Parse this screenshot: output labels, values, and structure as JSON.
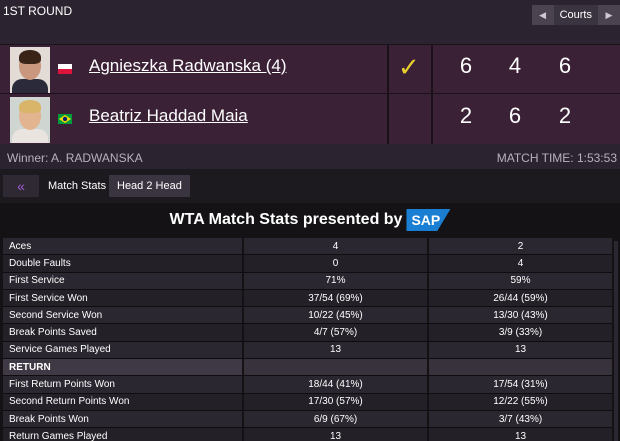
{
  "header": {
    "round": "1ST ROUND",
    "courts_label": "Courts",
    "prev_icon": "◀",
    "next_icon": "▶"
  },
  "players": [
    {
      "name": "Agnieszka Radwanska (4)",
      "flag": "poland",
      "winner_mark": "✓",
      "sets": [
        "6",
        "4",
        "6"
      ]
    },
    {
      "name": "Beatriz Haddad Maia",
      "flag": "brazil",
      "winner_mark": "",
      "sets": [
        "2",
        "6",
        "2"
      ]
    }
  ],
  "match": {
    "winner": "Winner: A. RADWANSKA",
    "time": "MATCH TIME: 1:53:53"
  },
  "tabs": {
    "back_icon": "«",
    "match_stats": "Match Stats",
    "head2head": "Head 2 Head"
  },
  "stats": {
    "sponsor_text": "WTA Match Stats presented by",
    "sponsor_logo": "SAP",
    "rows": [
      {
        "label": "Aces",
        "p1": "4",
        "p2": "2",
        "section": false
      },
      {
        "label": "Double Faults",
        "p1": "0",
        "p2": "4",
        "section": false
      },
      {
        "label": "First Service",
        "p1": "71%",
        "p2": "59%",
        "section": false
      },
      {
        "label": "First Service Won",
        "p1": "37/54 (69%)",
        "p2": "26/44 (59%)",
        "section": false
      },
      {
        "label": "Second Service Won",
        "p1": "10/22 (45%)",
        "p2": "13/30 (43%)",
        "section": false
      },
      {
        "label": "Break Points Saved",
        "p1": "4/7 (57%)",
        "p2": "3/9 (33%)",
        "section": false
      },
      {
        "label": "Service Games Played",
        "p1": "13",
        "p2": "13",
        "section": false
      },
      {
        "label": "RETURN",
        "p1": "",
        "p2": "",
        "section": true
      },
      {
        "label": "First Return Points Won",
        "p1": "18/44 (41%)",
        "p2": "17/54 (31%)",
        "section": false
      },
      {
        "label": "Second Return Points Won",
        "p1": "17/30 (57%)",
        "p2": "12/22 (55%)",
        "section": false
      },
      {
        "label": "Break Points Won",
        "p1": "6/9 (67%)",
        "p2": "3/7 (43%)",
        "section": false
      },
      {
        "label": "Return Games Played",
        "p1": "13",
        "p2": "13",
        "section": false
      }
    ]
  },
  "colors": {
    "accent": "#a25bd1",
    "check": "#e8cf2d",
    "panel": "#3b2136"
  }
}
